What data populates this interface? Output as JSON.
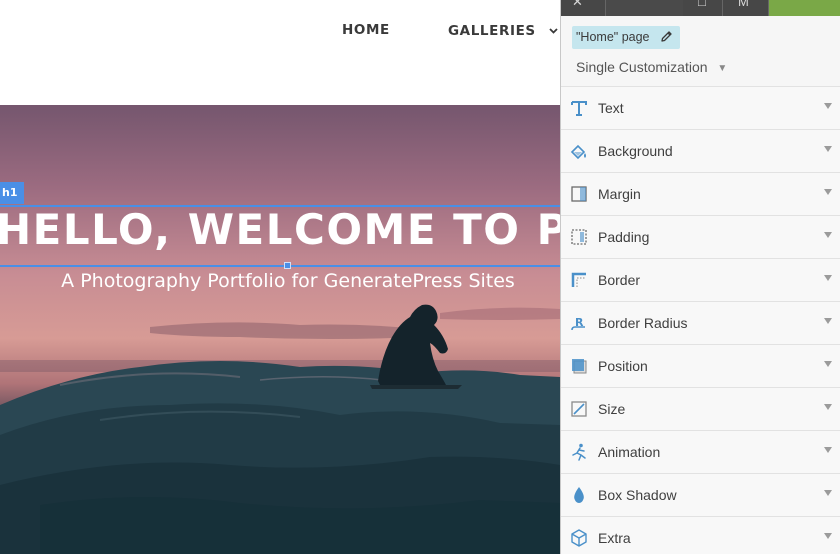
{
  "site": {
    "nav": [
      {
        "label": "HOME"
      },
      {
        "label": "GALLERIES"
      }
    ],
    "hero": {
      "element_tag": "h1",
      "title": "HELLO, WELCOME TO PIXEL",
      "subtitle": "A Photography Portfolio for GeneratePress Sites"
    }
  },
  "panel": {
    "page_label": "\"Home\" page",
    "mode": "Single Customization",
    "properties": [
      {
        "label": "Text",
        "icon": "text-icon"
      },
      {
        "label": "Background",
        "icon": "background-icon"
      },
      {
        "label": "Margin",
        "icon": "margin-icon"
      },
      {
        "label": "Padding",
        "icon": "padding-icon"
      },
      {
        "label": "Border",
        "icon": "border-icon"
      },
      {
        "label": "Border Radius",
        "icon": "border-radius-icon"
      },
      {
        "label": "Position",
        "icon": "position-icon"
      },
      {
        "label": "Size",
        "icon": "size-icon"
      },
      {
        "label": "Animation",
        "icon": "animation-icon"
      },
      {
        "label": "Box Shadow",
        "icon": "box-shadow-icon"
      },
      {
        "label": "Extra",
        "icon": "extra-icon"
      }
    ]
  },
  "colors": {
    "accent_blue": "#4a8fe6",
    "icon_blue": "#4a90c9",
    "page_tag_bg": "#c5e6ee",
    "green": "#7aa847"
  }
}
